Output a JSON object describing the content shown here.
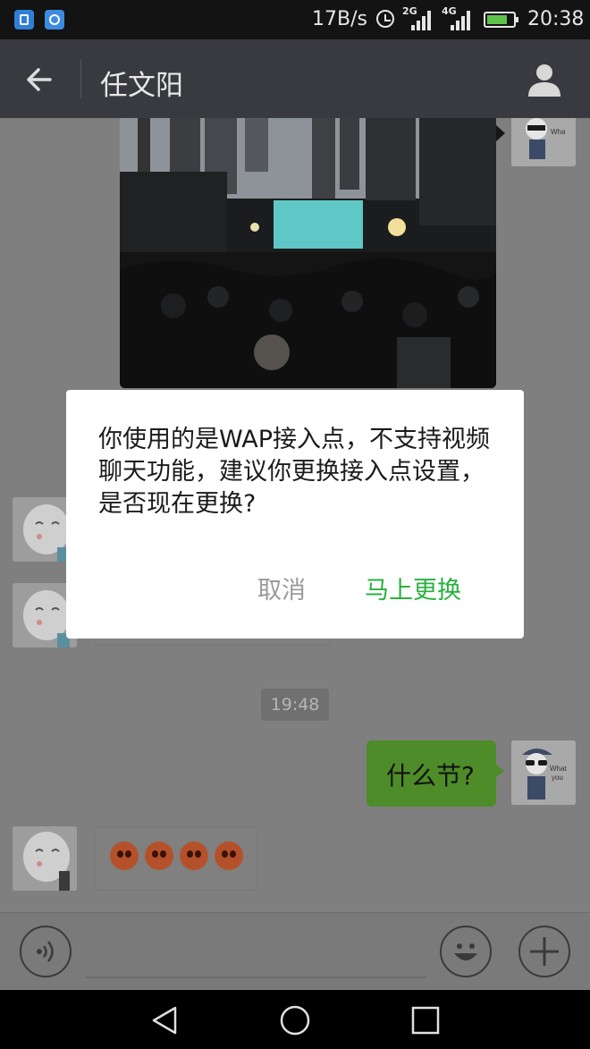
{
  "status_bar": {
    "network_speed": "17B/s",
    "signal1_label": "2G",
    "signal2_label": "4G",
    "time": "20:38",
    "icons": [
      "app-notification-icon",
      "app-notification-icon",
      "alarm-icon",
      "signal-icon",
      "signal-icon",
      "battery-charging-icon"
    ]
  },
  "header": {
    "title": "任文阳",
    "back_icon": "arrow-left-icon",
    "profile_icon": "person-icon"
  },
  "chat": {
    "timestamp": "19:48",
    "sent_message": "什么节?",
    "received_emoji_count": 4,
    "accent_color": "#4d8c29"
  },
  "input_bar": {
    "voice_icon": "voice-icon",
    "emoji_icon": "smiley-icon",
    "plus_icon": "plus-icon"
  },
  "dialog": {
    "message": "你使用的是WAP接入点，不支持视频聊天功能，建议你更换接入点设置，是否现在更换?",
    "cancel_label": "取消",
    "confirm_label": "马上更换",
    "confirm_color": "#2ab040"
  }
}
